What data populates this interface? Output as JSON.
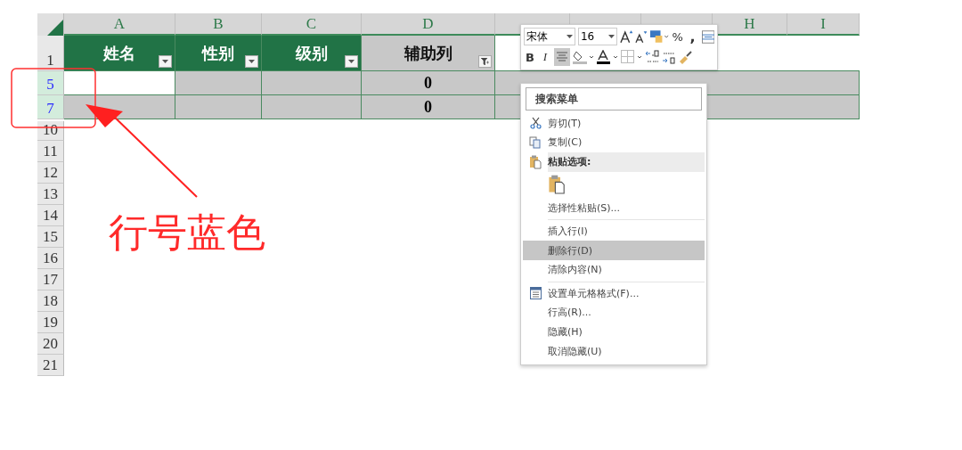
{
  "sheet": {
    "columns": [
      {
        "label": "A"
      },
      {
        "label": "B"
      },
      {
        "label": "C"
      },
      {
        "label": "D"
      },
      {},
      {},
      {},
      {
        "label": "H"
      },
      {
        "label": "I"
      }
    ],
    "header_row": {
      "number": "1",
      "selected": false,
      "cells": [
        {
          "text": "姓名",
          "kind": "field",
          "filtered": false
        },
        {
          "text": "性别",
          "kind": "field",
          "filtered": false
        },
        {
          "text": "级别",
          "kind": "field",
          "filtered": false
        },
        {
          "text": "辅助列",
          "kind": "helper",
          "filtered": true
        }
      ]
    },
    "rows": [
      {
        "number": "5",
        "selected": true,
        "cells": [
          {
            "filled": false
          },
          {
            "filled": true
          },
          {
            "filled": true
          },
          {
            "text": "0",
            "filled": true
          }
        ]
      },
      {
        "number": "7",
        "selected": true,
        "cells": [
          {
            "filled": true
          },
          {
            "filled": true
          },
          {
            "filled": true
          },
          {
            "text": "0",
            "filled": true
          }
        ]
      }
    ],
    "empty_rows": [
      "10",
      "11",
      "12",
      "13",
      "14",
      "15",
      "16",
      "17",
      "18",
      "19",
      "20",
      "21"
    ]
  },
  "mini_toolbar": {
    "font": "宋体",
    "size": "16",
    "percent": "%",
    "comma": ",",
    "bold": "B",
    "italic": "I"
  },
  "context_menu": {
    "search_placeholder": "搜索菜单",
    "items": [
      {
        "kind": "item",
        "label": "剪切(T)",
        "selected": false
      },
      {
        "kind": "item",
        "label": "复制(C)",
        "selected": false
      },
      {
        "kind": "header",
        "label": "粘贴选项:"
      },
      {
        "kind": "paste-icon"
      },
      {
        "kind": "item",
        "label": "选择性粘贴(S)...",
        "selected": false
      },
      {
        "kind": "separator"
      },
      {
        "kind": "item",
        "label": "插入行(I)",
        "selected": false
      },
      {
        "kind": "item",
        "label": "删除行(D)",
        "selected": true
      },
      {
        "kind": "item",
        "label": "清除内容(N)",
        "selected": false
      },
      {
        "kind": "separator"
      },
      {
        "kind": "item",
        "label": "设置单元格格式(F)...",
        "selected": false
      },
      {
        "kind": "item",
        "label": "行高(R)...",
        "selected": false
      },
      {
        "kind": "item",
        "label": "隐藏(H)",
        "selected": false
      },
      {
        "kind": "item",
        "label": "取消隐藏(U)",
        "selected": false
      }
    ]
  },
  "annotation": {
    "text": "行号蓝色"
  }
}
